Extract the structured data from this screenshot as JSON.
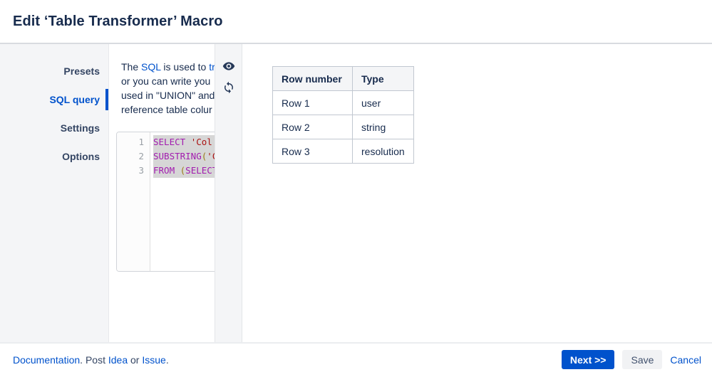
{
  "window": {
    "title": "Edit ‘Table Transformer’ Macro"
  },
  "sidebar": {
    "items": [
      {
        "label": "Presets",
        "active": false
      },
      {
        "label": "SQL query",
        "active": true
      },
      {
        "label": "Settings",
        "active": false
      },
      {
        "label": "Options",
        "active": false
      }
    ]
  },
  "sql_panel": {
    "description_lines": [
      [
        {
          "text": "The "
        },
        {
          "text": "SQL",
          "link": true
        },
        {
          "text": " is used to "
        },
        {
          "text": "tr",
          "link": true
        }
      ],
      [
        {
          "text": "or you can write you"
        }
      ],
      [
        {
          "text": "used in \"UNION\" and"
        }
      ],
      [
        {
          "text": "reference table colur"
        }
      ]
    ],
    "editor": {
      "lines": [
        {
          "number": "1",
          "tokens": [
            {
              "type": "keyword",
              "text": "SELECT "
            },
            {
              "type": "string",
              "text": "'Col"
            }
          ]
        },
        {
          "number": "2",
          "tokens": [
            {
              "type": "keyword",
              "text": "SUBSTRING"
            },
            {
              "type": "paren",
              "text": "("
            },
            {
              "type": "string",
              "text": "'C"
            }
          ]
        },
        {
          "number": "3",
          "tokens": [
            {
              "type": "keyword",
              "text": "FROM "
            },
            {
              "type": "paren",
              "text": "("
            },
            {
              "type": "keyword",
              "text": "SELECT"
            }
          ]
        }
      ]
    }
  },
  "toolbar": {
    "icons": [
      {
        "name": "preview-eye-icon"
      },
      {
        "name": "refresh-icon"
      }
    ]
  },
  "preview": {
    "table": {
      "columns": [
        "Row number",
        "Type"
      ],
      "rows": [
        [
          "Row 1",
          "user"
        ],
        [
          "Row 2",
          "string"
        ],
        [
          "Row 3",
          "resolution"
        ]
      ]
    }
  },
  "footer": {
    "links_segments": [
      {
        "text": "Documentation",
        "link": true
      },
      {
        "text": ". Post "
      },
      {
        "text": "Idea",
        "link": true
      },
      {
        "text": " or "
      },
      {
        "text": "Issue",
        "link": true
      },
      {
        "text": "."
      }
    ],
    "next_label": "Next >>",
    "save_label": "Save",
    "cancel_label": "Cancel"
  },
  "colors": {
    "accent": "#0052CC",
    "text": "#172B4D",
    "panel_bg": "#F4F5F7",
    "code_keyword": "#A21CAF",
    "code_string": "#AA1111",
    "code_paren": "#9A7B16",
    "selection": "#D6D6D6"
  }
}
